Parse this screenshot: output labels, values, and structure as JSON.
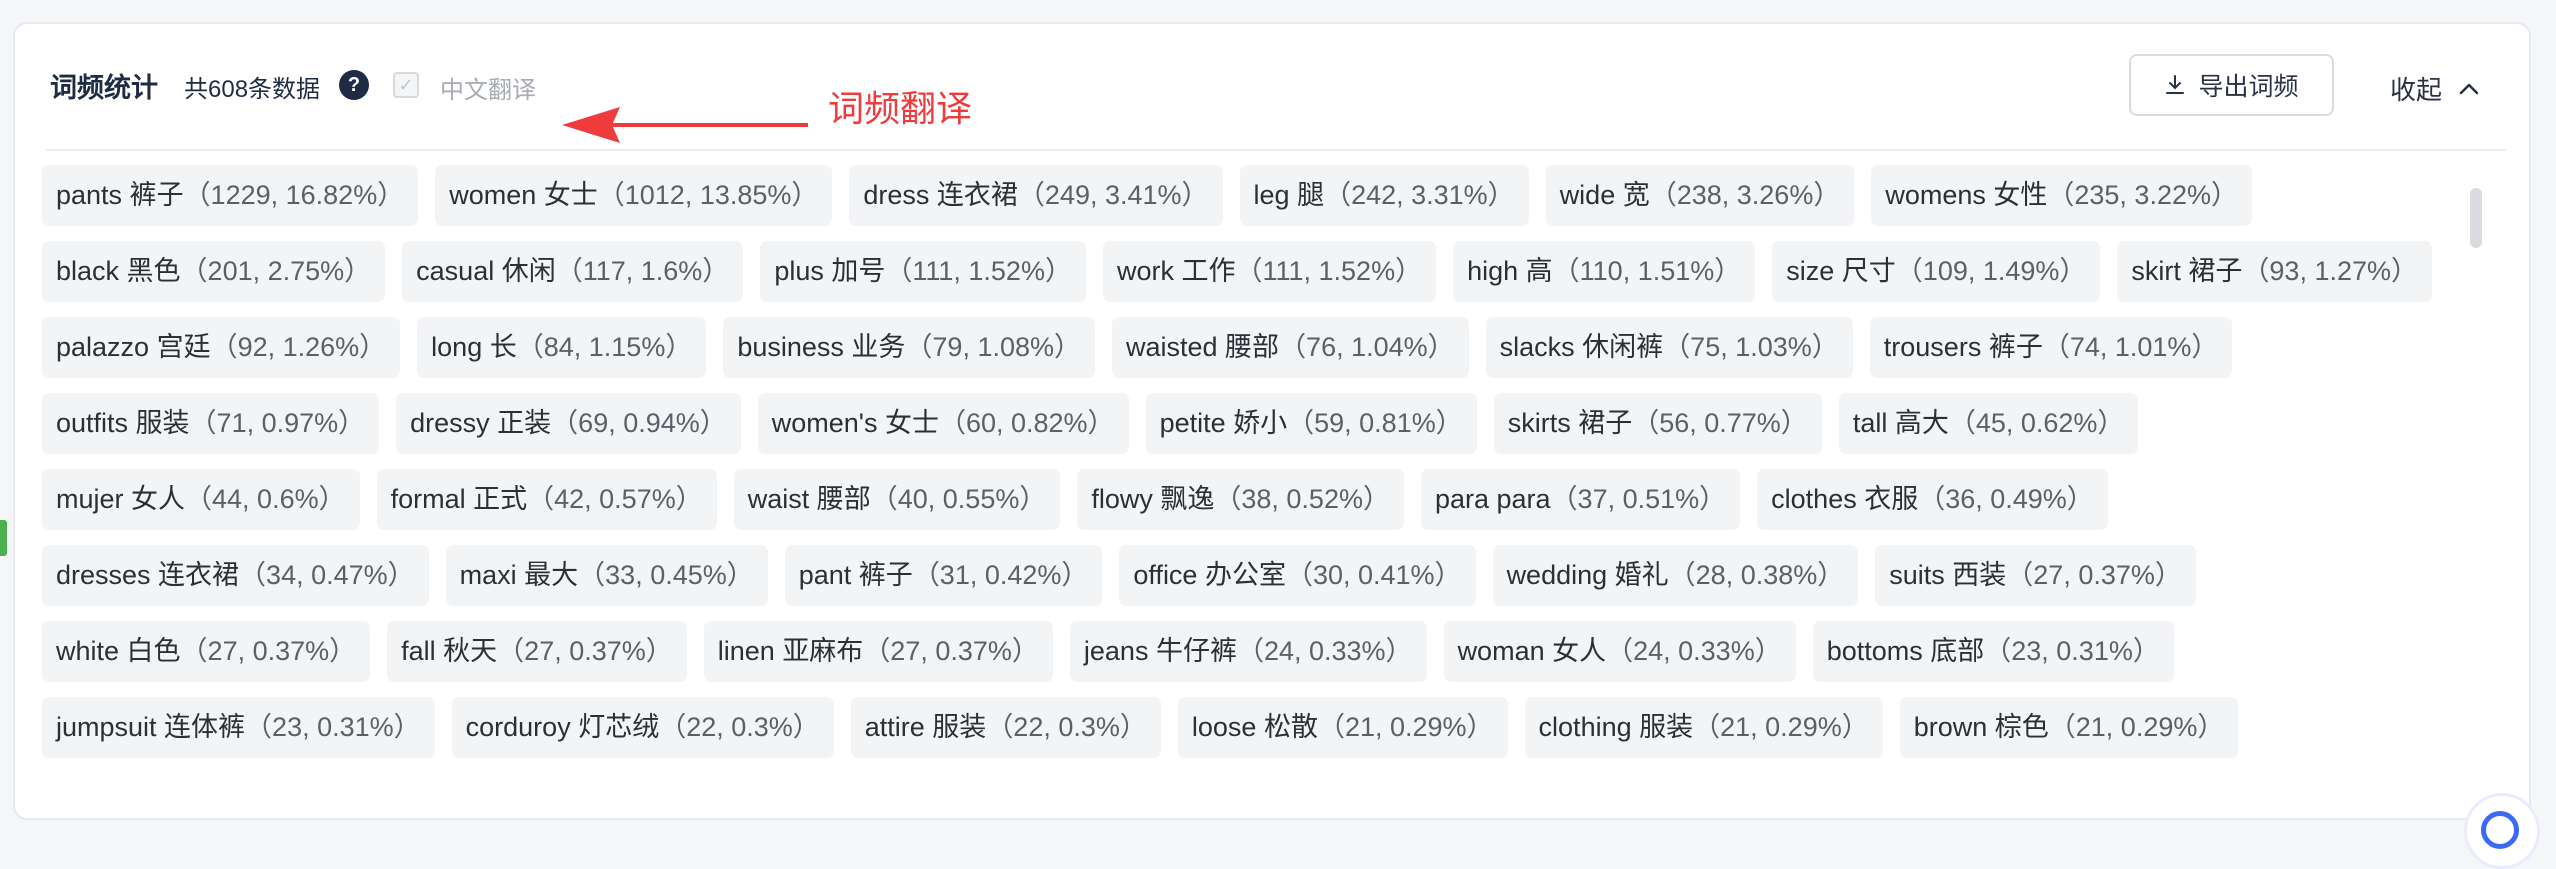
{
  "header": {
    "title": "词频统计",
    "count_text": "共608条数据",
    "help_glyph": "?",
    "translate_checkbox": {
      "checked": true,
      "label": "中文翻译",
      "check_glyph": "✓"
    },
    "annotation": {
      "text": "词频翻译",
      "color": "#ef3b3b"
    },
    "export_button_label": "导出词频",
    "collapse_label": "收起"
  },
  "tags": [
    [
      {
        "word": "pants 裤子",
        "stats": "（1229, 16.82%）"
      },
      {
        "word": "women 女士",
        "stats": "（1012, 13.85%）"
      },
      {
        "word": "dress 连衣裙",
        "stats": "（249, 3.41%）"
      },
      {
        "word": "leg 腿",
        "stats": "（242, 3.31%）"
      },
      {
        "word": "wide 宽",
        "stats": "（238, 3.26%）"
      },
      {
        "word": "womens 女性",
        "stats": "（235, 3.22%）"
      }
    ],
    [
      {
        "word": "black 黑色",
        "stats": "（201, 2.75%）"
      },
      {
        "word": "casual 休闲",
        "stats": "（117, 1.6%）"
      },
      {
        "word": "plus 加号",
        "stats": "（111, 1.52%）"
      },
      {
        "word": "work 工作",
        "stats": "（111, 1.52%）"
      },
      {
        "word": "high 高",
        "stats": "（110, 1.51%）"
      },
      {
        "word": "size 尺寸",
        "stats": "（109, 1.49%）"
      },
      {
        "word": "skirt 裙子",
        "stats": "（93, 1.27%）"
      }
    ],
    [
      {
        "word": "palazzo 宫廷",
        "stats": "（92, 1.26%）"
      },
      {
        "word": "long 长",
        "stats": "（84, 1.15%）"
      },
      {
        "word": "business 业务",
        "stats": "（79, 1.08%）"
      },
      {
        "word": "waisted 腰部",
        "stats": "（76, 1.04%）"
      },
      {
        "word": "slacks 休闲裤",
        "stats": "（75, 1.03%）"
      },
      {
        "word": "trousers 裤子",
        "stats": "（74, 1.01%）"
      }
    ],
    [
      {
        "word": "outfits 服装",
        "stats": "（71, 0.97%）"
      },
      {
        "word": "dressy 正装",
        "stats": "（69, 0.94%）"
      },
      {
        "word": "women's 女士",
        "stats": "（60, 0.82%）"
      },
      {
        "word": "petite 娇小",
        "stats": "（59, 0.81%）"
      },
      {
        "word": "skirts 裙子",
        "stats": "（56, 0.77%）"
      },
      {
        "word": "tall 高大",
        "stats": "（45, 0.62%）"
      }
    ],
    [
      {
        "word": "mujer 女人",
        "stats": "（44, 0.6%）"
      },
      {
        "word": "formal 正式",
        "stats": "（42, 0.57%）"
      },
      {
        "word": "waist 腰部",
        "stats": "（40, 0.55%）"
      },
      {
        "word": "flowy 飘逸",
        "stats": "（38, 0.52%）"
      },
      {
        "word": "para para",
        "stats": "（37, 0.51%）"
      },
      {
        "word": "clothes 衣服",
        "stats": "（36, 0.49%）"
      }
    ],
    [
      {
        "word": "dresses 连衣裙",
        "stats": "（34, 0.47%）"
      },
      {
        "word": "maxi 最大",
        "stats": "（33, 0.45%）"
      },
      {
        "word": "pant 裤子",
        "stats": "（31, 0.42%）"
      },
      {
        "word": "office 办公室",
        "stats": "（30, 0.41%）"
      },
      {
        "word": "wedding 婚礼",
        "stats": "（28, 0.38%）"
      },
      {
        "word": "suits 西装",
        "stats": "（27, 0.37%）"
      }
    ],
    [
      {
        "word": "white 白色",
        "stats": "（27, 0.37%）"
      },
      {
        "word": "fall 秋天",
        "stats": "（27, 0.37%）"
      },
      {
        "word": "linen 亚麻布",
        "stats": "（27, 0.37%）"
      },
      {
        "word": "jeans 牛仔裤",
        "stats": "（24, 0.33%）"
      },
      {
        "word": "woman 女人",
        "stats": "（24, 0.33%）"
      },
      {
        "word": "bottoms 底部",
        "stats": "（23, 0.31%）"
      }
    ],
    [
      {
        "word": "jumpsuit 连体裤",
        "stats": "（23, 0.31%）"
      },
      {
        "word": "corduroy 灯芯绒",
        "stats": "（22, 0.3%）"
      },
      {
        "word": "attire 服装",
        "stats": "（22, 0.3%）"
      },
      {
        "word": "loose 松散",
        "stats": "（21, 0.29%）"
      },
      {
        "word": "clothing 服装",
        "stats": "（21, 0.29%）"
      },
      {
        "word": "brown 棕色",
        "stats": "（21, 0.29%）"
      }
    ]
  ]
}
